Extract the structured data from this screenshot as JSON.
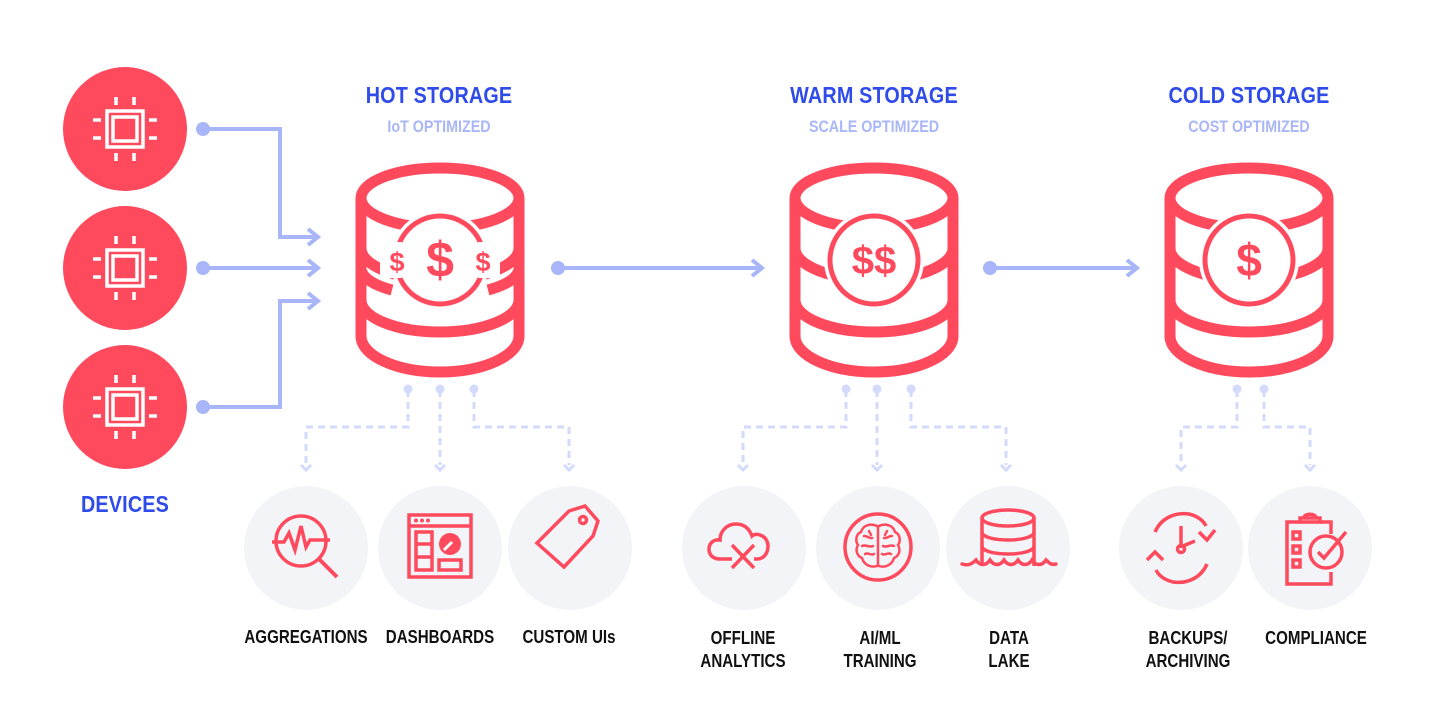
{
  "colors": {
    "accent_red": "#FF4A5E",
    "title_blue": "#2F4BEA",
    "subtitle_lavender": "#A9B6F7",
    "connector": "#A8B5F8",
    "dashed_connector": "#D3DAFB",
    "use_circle_bg": "#F3F4F7",
    "label_text": "#111111"
  },
  "devices": {
    "label": "DEVICES",
    "items": [
      {
        "icon": "chip-icon"
      },
      {
        "icon": "chip-icon"
      },
      {
        "icon": "chip-icon"
      }
    ]
  },
  "tiers": [
    {
      "title": "HOT STORAGE",
      "subtitle": "IoT OPTIMIZED",
      "icon": "database-dollar-icon",
      "cost_symbols": "$ $ $",
      "uses": [
        {
          "label": "AGGREGATIONS",
          "icon": "analytics-search-icon"
        },
        {
          "label": "DASHBOARDS",
          "icon": "dashboard-icon"
        },
        {
          "label": "CUSTOM UIs",
          "icon": "tag-icon"
        }
      ]
    },
    {
      "title": "WARM STORAGE",
      "subtitle": "SCALE OPTIMIZED",
      "icon": "database-dollar-icon",
      "cost_symbols": "$$",
      "uses": [
        {
          "label": "OFFLINE\nANALYTICS",
          "icon": "cloud-offline-icon"
        },
        {
          "label": "AI/ML\nTRAINING",
          "icon": "brain-icon"
        },
        {
          "label": "DATA\nLAKE",
          "icon": "data-lake-icon"
        }
      ]
    },
    {
      "title": "COLD STORAGE",
      "subtitle": "COST OPTIMIZED",
      "icon": "database-dollar-icon",
      "cost_symbols": "$",
      "uses": [
        {
          "label": "BACKUPS/\nARCHIVING",
          "icon": "backup-clock-icon"
        },
        {
          "label": "COMPLIANCE",
          "icon": "compliance-clipboard-icon"
        }
      ]
    }
  ]
}
